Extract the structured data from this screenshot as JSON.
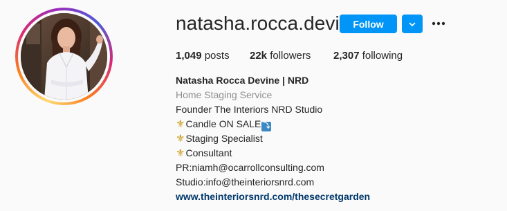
{
  "profile": {
    "username": "natasha.rocca.devine",
    "follow_label": "Follow"
  },
  "stats": {
    "posts_count": "1,049",
    "posts_label": "posts",
    "followers_count": "22k",
    "followers_label": "followers",
    "following_count": "2,307",
    "following_label": "following"
  },
  "bio": {
    "full_name": "Natasha Rocca Devine | NRD",
    "category": "Home Staging Service",
    "line1": "Founder The Interiors NRD Studio",
    "line2": "Candle ON SALE",
    "line3": "Staging Specialist",
    "line4": "Consultant",
    "line5": "PR:niamh@ocarrollconsulting.com",
    "line6": "Studio:info@theinteriorsnrd.com",
    "website": "www.theinteriorsnrd.com/thesecretgarden"
  },
  "icons": {
    "dropdown": "chevron-down-icon",
    "more": "more-options-icon",
    "bullet": "fleur-de-lis-icon",
    "badge": "down-arrow-badge-icon"
  },
  "colors": {
    "accent": "#0095f6",
    "link": "#00376b",
    "muted": "#8e8e8e",
    "text": "#262626"
  }
}
